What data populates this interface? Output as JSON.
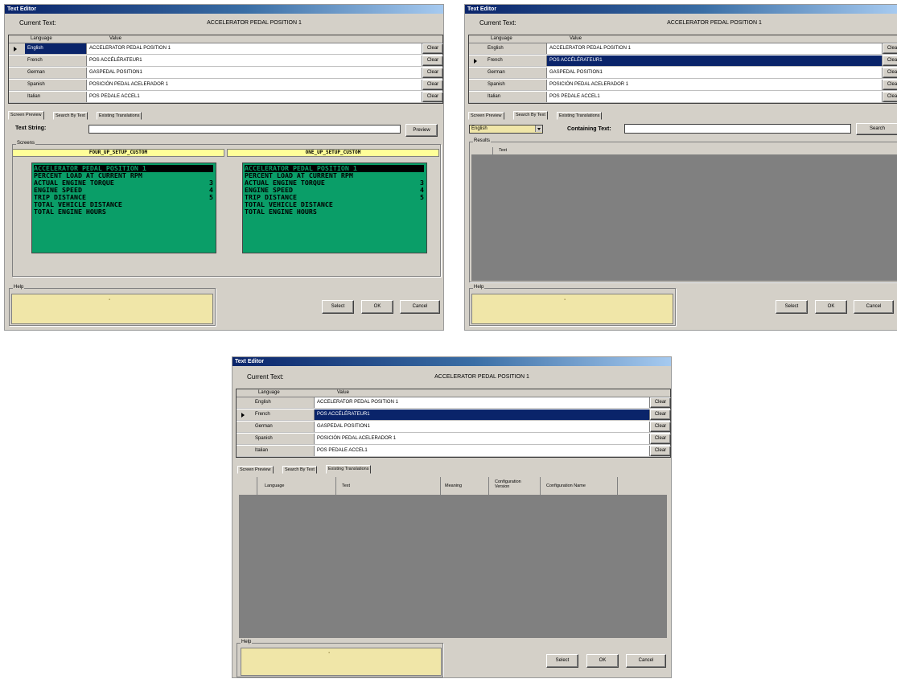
{
  "window_title": "Text Editor",
  "current_text_label": "Current Text:",
  "current_text_value": "ACCELERATOR PEDAL POSITION 1",
  "grid_headers": {
    "language": "Language",
    "value": "Value"
  },
  "clear_label": "Clear",
  "translations": [
    {
      "language": "English",
      "value": "ACCELERATOR PEDAL POSITION 1"
    },
    {
      "language": "French",
      "value": "POS ACCÉLÉRATEUR1"
    },
    {
      "language": "German",
      "value": "GASPEDAL POSITION1"
    },
    {
      "language": "Spanish",
      "value": "POSICIÓN PEDAL ACELERADOR 1"
    },
    {
      "language": "Italian",
      "value": "POS PEDALE ACCEL1"
    }
  ],
  "tabs": [
    "Screen Preview",
    "Search By Text",
    "Existing Translations"
  ],
  "preview": {
    "text_string_label": "Text String:",
    "preview_button": "Preview",
    "screens_label": "Screens",
    "screens": [
      {
        "name": "FOUR_UP_SETUP_CUSTOM",
        "lines": [
          {
            "text": "ACCELERATOR PEDAL POSITION 1",
            "num": ""
          },
          {
            "text": "PERCENT LOAD AT CURRENT RPM",
            "num": ""
          },
          {
            "text": "ACTUAL ENGINE TORQUE",
            "num": "3"
          },
          {
            "text": "ENGINE SPEED",
            "num": "4"
          },
          {
            "text": "TRIP DISTANCE",
            "num": "5"
          },
          {
            "text": "TOTAL VEHICLE DISTANCE",
            "num": ""
          },
          {
            "text": "TOTAL ENGINE HOURS",
            "num": ""
          }
        ]
      },
      {
        "name": "ONE_UP_SETUP_CUSTOM",
        "lines": [
          {
            "text": "ACCELERATOR PEDAL POSITION 1",
            "num": ""
          },
          {
            "text": "PERCENT LOAD AT CURRENT RPM",
            "num": ""
          },
          {
            "text": "ACTUAL ENGINE TORQUE",
            "num": "3"
          },
          {
            "text": "ENGINE SPEED",
            "num": "4"
          },
          {
            "text": "TRIP DISTANCE",
            "num": "5"
          },
          {
            "text": "TOTAL VEHICLE DISTANCE",
            "num": ""
          },
          {
            "text": "TOTAL ENGINE HOURS",
            "num": ""
          }
        ]
      }
    ]
  },
  "search": {
    "language_selected": "English",
    "containing_text_label": "Containing Text:",
    "search_button": "Search",
    "results_label": "Results",
    "results_column": "Text"
  },
  "existing": {
    "columns": [
      "Language",
      "Text",
      "Meaning",
      "Configuration Version",
      "Configuration Name"
    ]
  },
  "help_label": "Help",
  "help_marker": "▪",
  "buttons": {
    "select": "Select",
    "ok": "OK",
    "cancel": "Cancel"
  },
  "colors": {
    "lcd": "#0a9e68",
    "help": "#f0e6a8",
    "selection": "#0a246a",
    "title_start": "#0a246a"
  }
}
